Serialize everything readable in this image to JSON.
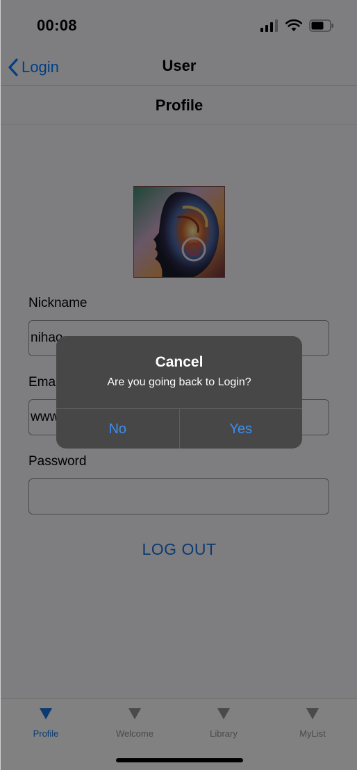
{
  "status_bar": {
    "time": "00:08"
  },
  "nav": {
    "back_label": "Login",
    "title": "User"
  },
  "section": {
    "title": "Profile"
  },
  "form": {
    "nickname_label": "Nickname",
    "nickname_value": "nihao",
    "email_label": "Email",
    "email_value": "www",
    "password_label": "Password",
    "password_value": ""
  },
  "logout_label": "LOG OUT",
  "tabs": [
    {
      "label": "Profile",
      "active": true
    },
    {
      "label": "Welcome",
      "active": false
    },
    {
      "label": "Library",
      "active": false
    },
    {
      "label": "MyList",
      "active": false
    }
  ],
  "alert": {
    "title": "Cancel",
    "message": "Are you going back to Login?",
    "no_label": "No",
    "yes_label": "Yes"
  },
  "colors": {
    "accent": "#007aff",
    "link": "#1a6fd9",
    "alert_bg": "#474747",
    "alert_button": "#3b8ef0"
  },
  "icons": {
    "back": "chevron-left-icon",
    "signal": "signal-icon",
    "wifi": "wifi-icon",
    "battery": "battery-icon",
    "tab": "triangle-down-icon"
  }
}
